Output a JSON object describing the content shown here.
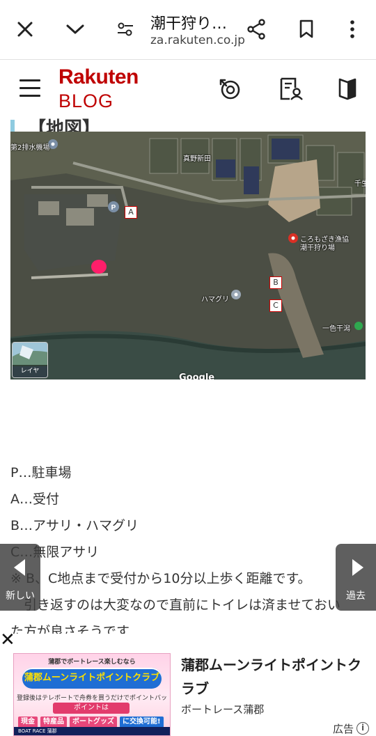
{
  "browser": {
    "page_title": "潮干狩り…",
    "url": "za.rakuten.co.jp",
    "icons": [
      "close-icon",
      "chevron-down-icon",
      "tune-icon",
      "share-icon",
      "bookmark-icon",
      "more-vert-icon"
    ]
  },
  "blog_header": {
    "logo_main": "Rakuten",
    "logo_sub": "BLOG",
    "icons": [
      "menu-icon",
      "recent-activity-icon",
      "profile-doc-icon",
      "book-icon"
    ]
  },
  "map": {
    "labels": {
      "pumping_station": "第2排水機場",
      "shinden": "真野新田",
      "shore": "千生",
      "korogi": "ころもざき漁協",
      "korogi2": "潮干狩り場",
      "hamaguri": "ハマグリ",
      "ichishiki": "一色干潟",
      "layer": "レイヤ",
      "google": "Google"
    },
    "markers": {
      "a": "A",
      "b": "B",
      "c": "C",
      "p": "P"
    },
    "colors": {
      "water": "#4b4e44",
      "land": "#5b5d4e",
      "pin_red": "#d93025",
      "pin_gray": "#7b8fa6",
      "pin_green": "#2fa84f",
      "highlight": "#ff1e6a"
    }
  },
  "article": {
    "lines": [
      "P…駐車場",
      "A…受付",
      "B…アサリ・ハマグリ",
      "C…無限アサリ",
      "※ B、C地点まで受付から10分以上歩く距離です。",
      "　引き返すのは大変なので直前にトイレは済ませておい",
      "た方が良さそうです"
    ]
  },
  "nav": {
    "prev_label": "新しい",
    "next_label": "過去"
  },
  "ad": {
    "close": "✕",
    "image_top_text": "蒲郡でボートレース楽しむなら",
    "image_headline": "蒲郡ムーンライトポイントクラブ",
    "image_mid_text": "登録後はテレボートで舟券を買うだけでポイントバック!",
    "image_points": "ポイントは",
    "image_tags": [
      "現金",
      "特産品",
      "ボートグッズ",
      "に交換可能!"
    ],
    "image_footer": "BOAT RACE 蒲郡",
    "title": "蒲郡ムーンライトポイントクラブ",
    "advertiser": "ボートレース蒲郡",
    "label": "広告",
    "info_icon": "i"
  }
}
